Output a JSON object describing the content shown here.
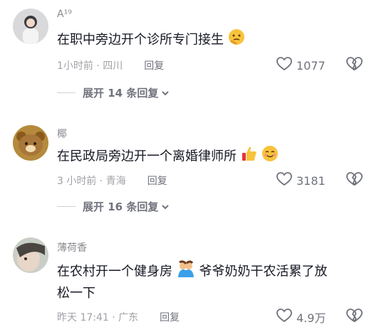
{
  "comments": [
    {
      "username": "A¹⁹",
      "text": "在职中旁边开个诊所专门接生",
      "meta": "1小时前 · 四川",
      "reply_label": "回复",
      "likes": "1077",
      "expand_label": "展开 14 条回复"
    },
    {
      "username": "椰",
      "text": "在民政局旁边开一个离婚律师所",
      "meta": "3 小时前 · 青海",
      "reply_label": "回复",
      "likes": "3181",
      "expand_label": "展开 16 条回复"
    },
    {
      "username": "薄荷香",
      "text_line1": "在农村开一个健身房",
      "text_line1b": "爷爷奶奶干农活累了放",
      "text_line2": "松一下",
      "meta": "昨天 17:41 · 广东",
      "reply_label": "回复",
      "likes": "4.9万"
    }
  ],
  "icons": [
    "heart-outline-icon",
    "broken-heart-icon",
    "chevron-down-icon",
    "thinking-face-emoji",
    "thumbs-up-emoji",
    "smiling-face-emoji",
    "hugging-people-emoji"
  ],
  "colors": {
    "text": "#161823",
    "secondary": "#a1a2a7",
    "action": "#70727c"
  }
}
